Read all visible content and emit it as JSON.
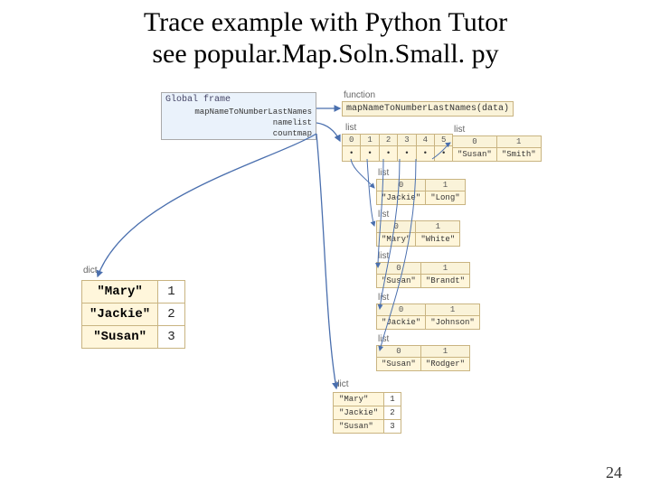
{
  "title_line1": "Trace example with Python Tutor",
  "title_line2": "see popular.Map.Soln.Small. py",
  "page_number": "24",
  "global_frame": {
    "title": "Global frame",
    "vars": [
      "mapNameToNumberLastNames",
      "namelist",
      "countmap"
    ]
  },
  "function_label": "function",
  "function_sig": "mapNameToNumberLastNames(data)",
  "type_list": "list",
  "type_dict": "dict",
  "namelist_indices": [
    "0",
    "1",
    "2",
    "3",
    "4",
    "5"
  ],
  "namelist_entries": [
    {
      "idx": [
        "0",
        "1"
      ],
      "vals": [
        "\"Susan\"",
        "\"Smith\""
      ]
    },
    {
      "idx": [
        "0",
        "1"
      ],
      "vals": [
        "\"Jackie\"",
        "\"Long\""
      ]
    },
    {
      "idx": [
        "0",
        "1"
      ],
      "vals": [
        "\"Mary\"",
        "\"White\""
      ]
    },
    {
      "idx": [
        "0",
        "1"
      ],
      "vals": [
        "\"Susan\"",
        "\"Brandt\""
      ]
    },
    {
      "idx": [
        "0",
        "1"
      ],
      "vals": [
        "\"Jackie\"",
        "\"Johnson\""
      ]
    },
    {
      "idx": [
        "0",
        "1"
      ],
      "vals": [
        "\"Susan\"",
        "\"Rodger\""
      ]
    }
  ],
  "countmap_big": [
    {
      "k": "\"Mary\"",
      "v": "1"
    },
    {
      "k": "\"Jackie\"",
      "v": "2"
    },
    {
      "k": "\"Susan\"",
      "v": "3"
    }
  ],
  "countmap_small": [
    {
      "k": "\"Mary\"",
      "v": "1"
    },
    {
      "k": "\"Jackie\"",
      "v": "2"
    },
    {
      "k": "\"Susan\"",
      "v": "3"
    }
  ]
}
